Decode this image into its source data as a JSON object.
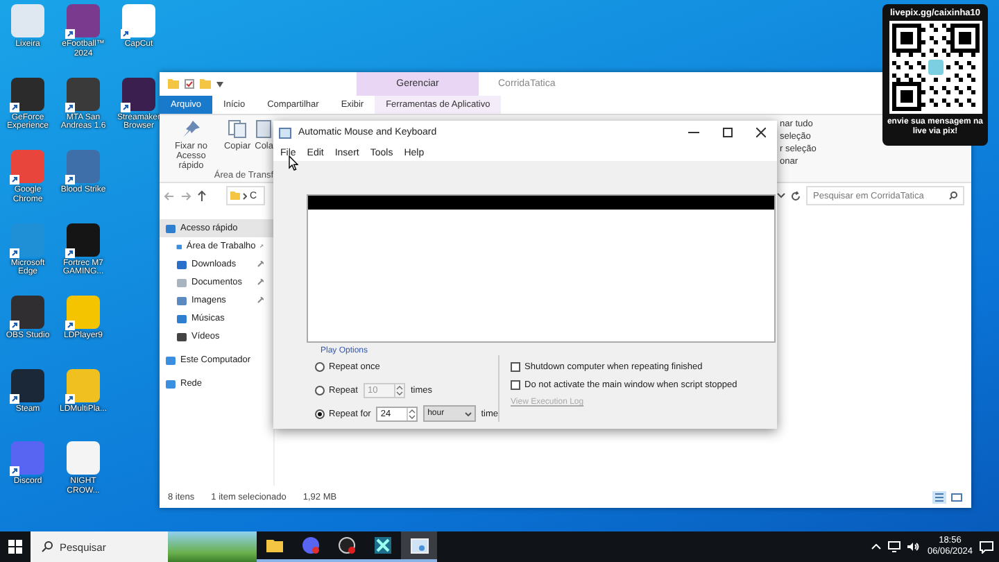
{
  "desktop_icons": [
    {
      "label": "Lixeira",
      "color": "#dfe8f0",
      "shortcut": false
    },
    {
      "label": "GeForce Experience",
      "color": "#2b2b2b",
      "shortcut": true
    },
    {
      "label": "Google Chrome",
      "color": "#e8453c",
      "shortcut": true
    },
    {
      "label": "Microsoft Edge",
      "color": "#1f8fd6",
      "shortcut": true
    },
    {
      "label": "OBS Studio",
      "color": "#302e31",
      "shortcut": true
    },
    {
      "label": "Steam",
      "color": "#1b2838",
      "shortcut": true
    },
    {
      "label": "Discord",
      "color": "#5865f2",
      "shortcut": true
    },
    {
      "label": "eFootball™ 2024",
      "color": "#7a3b8f",
      "shortcut": true
    },
    {
      "label": "MTA San Andreas 1.6",
      "color": "#3a3a3a",
      "shortcut": true
    },
    {
      "label": "Blood Strike",
      "color": "#3f6fa8",
      "shortcut": true
    },
    {
      "label": "Fortrec M7 GAMING...",
      "color": "#151515",
      "shortcut": true
    },
    {
      "label": "LDPlayer9",
      "color": "#f5c400",
      "shortcut": true
    },
    {
      "label": "LDMultiPla...",
      "color": "#f0c020",
      "shortcut": true
    },
    {
      "label": "NIGHT CROW...",
      "color": "#f4f4f4",
      "shortcut": false
    },
    {
      "label": "CapCut",
      "color": "#ffffff",
      "shortcut": true
    },
    {
      "label": "Streamaker Browser",
      "color": "#3b1f4f",
      "shortcut": true
    }
  ],
  "explorer": {
    "context_tab": "Gerenciar",
    "title": "CorridaTatica",
    "tabs": [
      {
        "label": "Arquivo",
        "selected": true
      },
      {
        "label": "Início",
        "selected": false
      },
      {
        "label": "Compartilhar",
        "selected": false
      },
      {
        "label": "Exibir",
        "selected": false
      },
      {
        "label": "Ferramentas de Aplicativo",
        "selected": false
      }
    ],
    "ribbon": {
      "buttons": [
        {
          "label": "Fixar no Acesso rápido",
          "kind": "pin"
        },
        {
          "label": "Copiar",
          "kind": "copy"
        },
        {
          "label": "Cola",
          "kind": "paste"
        }
      ],
      "group_label": "Área de Transf",
      "right_items": [
        "nar tudo",
        "seleção",
        "r seleção",
        "onar"
      ]
    },
    "address": "C",
    "search": {
      "placeholder": "Pesquisar em CorridaTatica"
    },
    "nav": [
      {
        "label": "Acesso rápido",
        "kind": "star",
        "selected": true,
        "children": [
          {
            "label": "Área de Trabalho",
            "kind": "desktop",
            "pinned": true
          },
          {
            "label": "Downloads",
            "kind": "download",
            "pinned": true
          },
          {
            "label": "Documentos",
            "kind": "document",
            "pinned": true
          },
          {
            "label": "Imagens",
            "kind": "picture",
            "pinned": true
          },
          {
            "label": "Músicas",
            "kind": "music",
            "pinned": false
          },
          {
            "label": "Vídeos",
            "kind": "video",
            "pinned": false
          }
        ]
      },
      {
        "label": "Este Computador",
        "kind": "computer",
        "selected": false
      },
      {
        "label": "Rede",
        "kind": "network",
        "selected": false
      }
    ],
    "status": {
      "count": "8 itens",
      "selection": "1 item selecionado",
      "size": "1,92 MB"
    }
  },
  "dialog": {
    "title": "Automatic Mouse and Keyboard",
    "menu": [
      "File",
      "Edit",
      "Insert",
      "Tools",
      "Help"
    ],
    "play_options_label": "Play Options",
    "repeat_options": [
      {
        "kind": "once",
        "label": "Repeat once",
        "selected": false
      },
      {
        "kind": "count",
        "label": "Repeat",
        "selected": false,
        "value": "10",
        "unit": "times",
        "disabled": true
      },
      {
        "kind": "duration",
        "label": "Repeat for",
        "selected": true,
        "value": "24",
        "unit_select": "hour",
        "suffix": "time",
        "disabled": false
      }
    ],
    "checkboxes": [
      {
        "label": "Shutdown computer when repeating finished",
        "checked": false
      },
      {
        "label": "Do not activate the main window when script stopped",
        "checked": false
      }
    ],
    "log_link": {
      "label": "View Execution Log",
      "disabled": true
    }
  },
  "taskbar": {
    "search_placeholder": "Pesquisar",
    "apps": [
      {
        "kind": "folder",
        "active": false
      },
      {
        "kind": "chat",
        "active": false
      },
      {
        "kind": "recorder",
        "active": false
      },
      {
        "kind": "game",
        "active": false
      },
      {
        "kind": "window",
        "active": true
      }
    ],
    "time": "18:56",
    "date": "06/06/2024"
  },
  "overlay": {
    "url": "livepix.gg/caixinha10",
    "message": "envie sua mensagem na live via pix!"
  }
}
